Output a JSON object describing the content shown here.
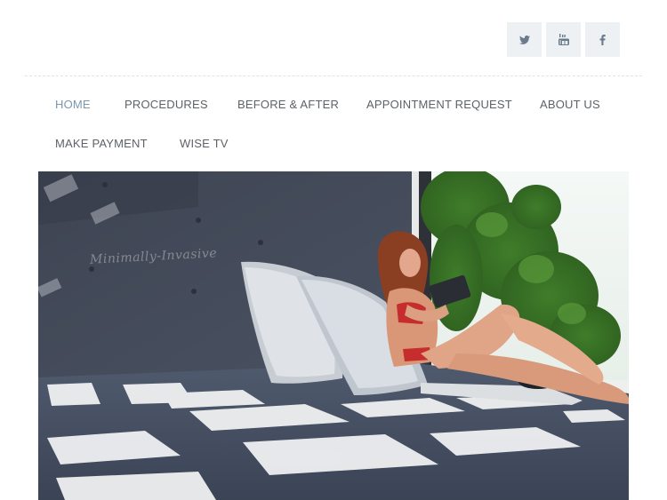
{
  "social": [
    {
      "name": "twitter-icon",
      "label": "Twitter"
    },
    {
      "name": "youtube-icon",
      "label": "YouTube"
    },
    {
      "name": "facebook-icon",
      "label": "Facebook"
    }
  ],
  "nav": {
    "home": "HOME",
    "procedures": "PROCEDURES",
    "before_after": "BEFORE & AFTER",
    "appointment": "APPOINTMENT REQUEST",
    "about": "ABOUT US",
    "payment": "MAKE PAYMENT",
    "wisetv": "WISE TV"
  },
  "hero": {
    "watermark": "Minimally-Invasive"
  },
  "colors": {
    "nav_active": "#7b96ad",
    "nav_text": "#5d6268",
    "social_bg": "#eef1f4",
    "social_icon": "#6b7a8c"
  }
}
